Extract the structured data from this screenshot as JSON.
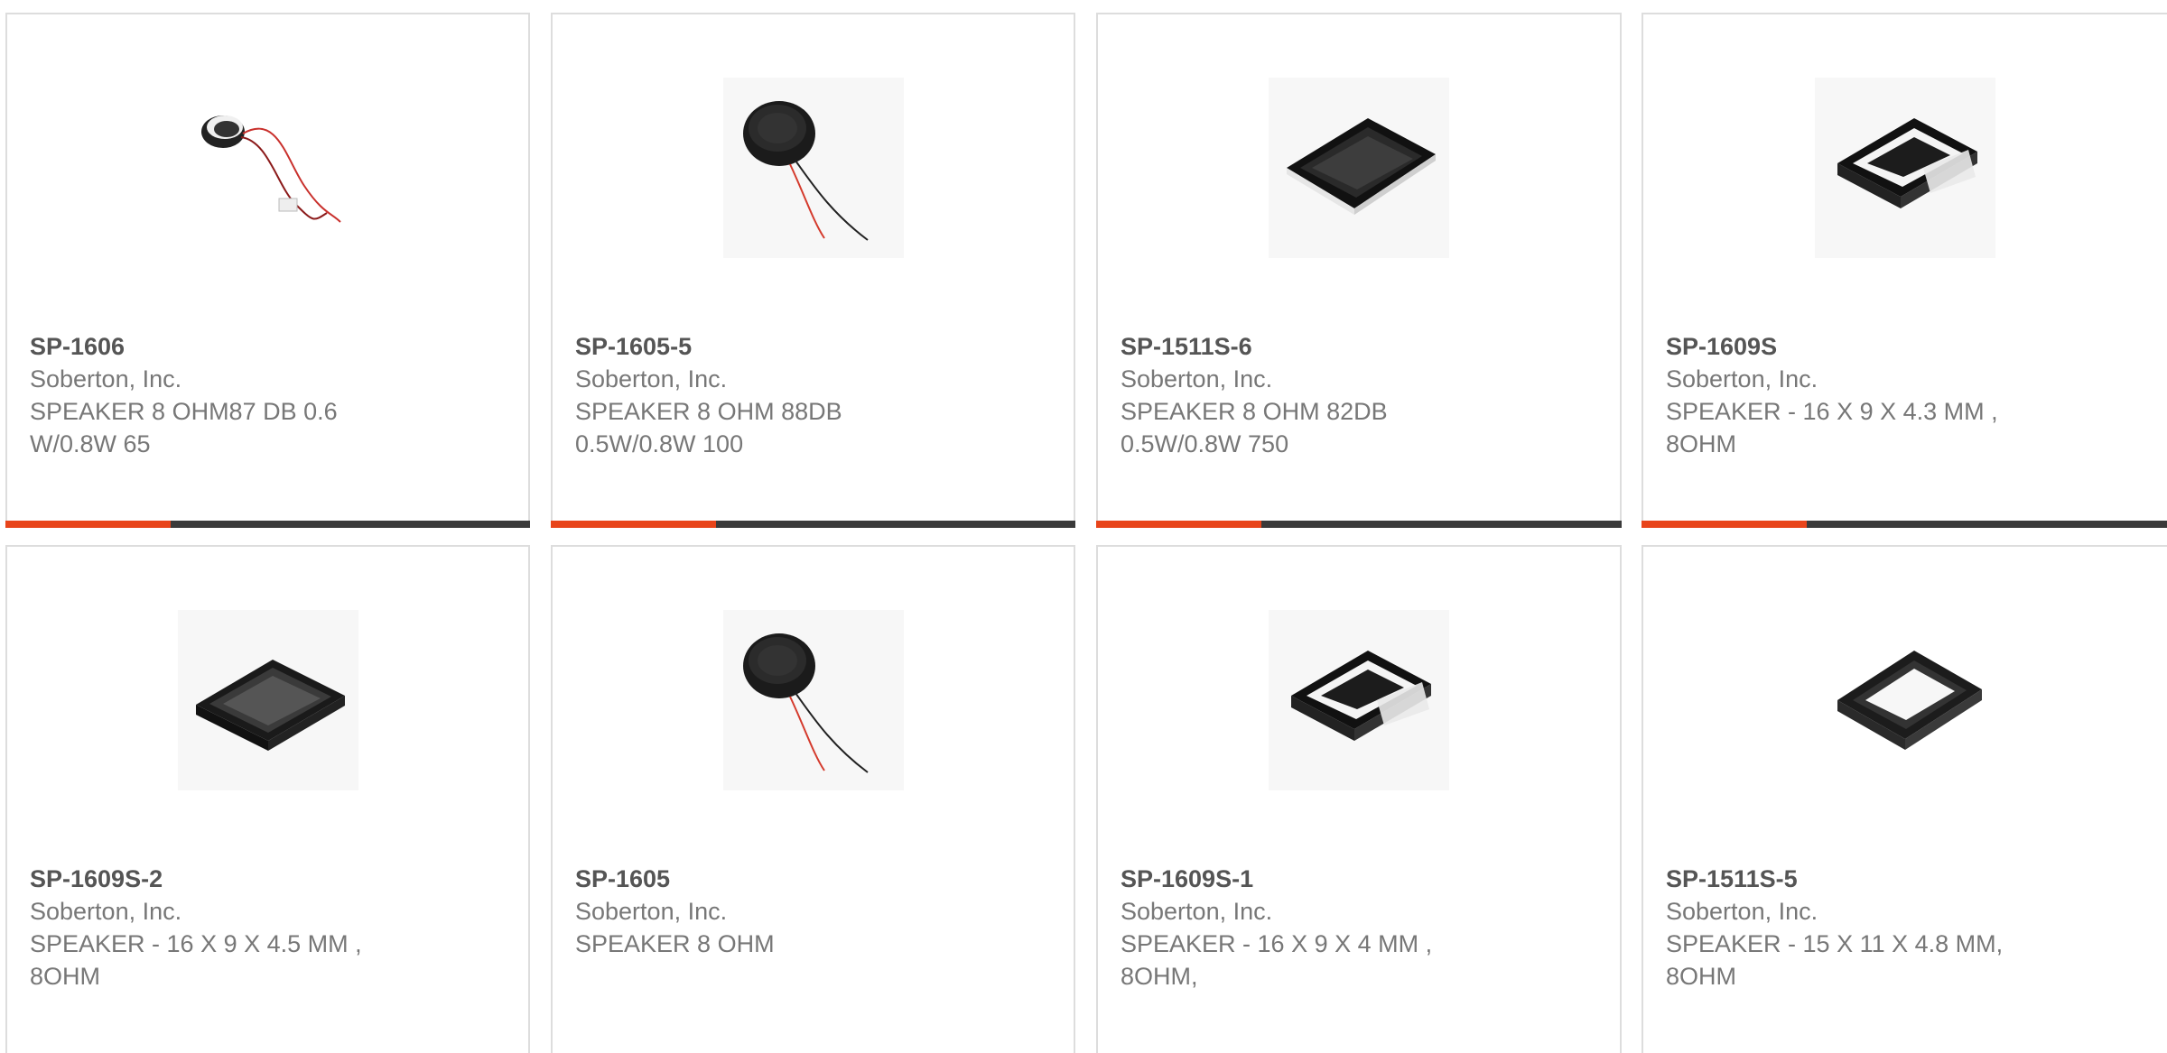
{
  "colors": {
    "accent": "#e8441a",
    "bar": "#3a3a3a",
    "border": "#dddddd",
    "part_text": "#555555",
    "body_text": "#777777"
  },
  "products": [
    {
      "part": "SP-1606",
      "manufacturer": "Soberton, Inc.",
      "desc1": "SPEAKER 8 OHM87 DB 0.6",
      "desc2": "W/0.8W 65",
      "image": "round-speaker-with-red-wire-and-connector"
    },
    {
      "part": "SP-1605-5",
      "manufacturer": "Soberton, Inc.",
      "desc1": "SPEAKER 8 OHM 88DB",
      "desc2": "0.5W/0.8W 100",
      "image": "round-speaker-with-wires"
    },
    {
      "part": "SP-1511S-6",
      "manufacturer": "Soberton, Inc.",
      "desc1": "SPEAKER 8 OHM 82DB",
      "desc2": "0.5W/0.8W 750",
      "image": "rectangular-speaker"
    },
    {
      "part": "SP-1609S",
      "manufacturer": "Soberton, Inc.",
      "desc1": "SPEAKER - 16 X 9 X 4.3 MM ,",
      "desc2": "8OHM",
      "image": "rectangular-speaker-with-tab"
    },
    {
      "part": "SP-1609S-2",
      "manufacturer": "Soberton, Inc.",
      "desc1": "SPEAKER - 16 X 9 X 4.5 MM ,",
      "desc2": "8OHM",
      "image": "rectangular-speaker-dark"
    },
    {
      "part": "SP-1605",
      "manufacturer": "Soberton, Inc.",
      "desc1": "SPEAKER 8 OHM",
      "desc2": "",
      "image": "round-speaker-with-wires"
    },
    {
      "part": "SP-1609S-1",
      "manufacturer": "Soberton, Inc.",
      "desc1": "SPEAKER - 16 X 9 X 4 MM ,",
      "desc2": "8OHM,",
      "image": "rectangular-speaker-with-tab"
    },
    {
      "part": "SP-1511S-5",
      "manufacturer": "Soberton, Inc.",
      "desc1": "SPEAKER - 15 X 11 X 4.8 MM,",
      "desc2": "8OHM",
      "image": "rectangular-speaker-white-membrane"
    }
  ]
}
